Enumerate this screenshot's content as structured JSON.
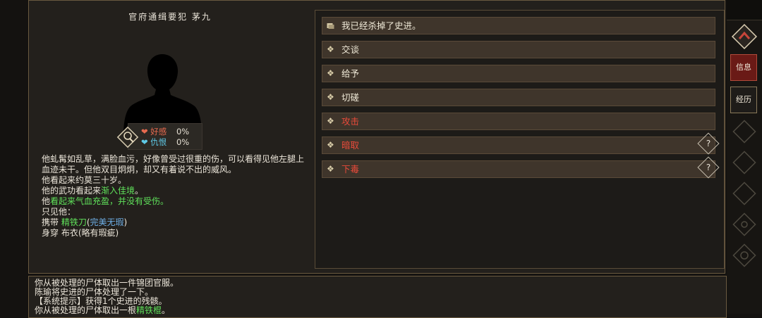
{
  "npc": {
    "title": "官府通缉要犯 茅九",
    "stats": [
      {
        "icon": "heart-icon",
        "label": "好感",
        "value": "0%",
        "color": "#e86a4f"
      },
      {
        "icon": "heart-icon",
        "label": "仇恨",
        "value": "0%",
        "color": "#5fc9e6"
      }
    ],
    "description": [
      {
        "segments": [
          {
            "text": "他虬髯如乱草，满脸血污，好像曾受过很重的伤，可以看得见他左腿上血迹未干。但他双目炯炯，却又有着说不出的威风。",
            "style": ""
          }
        ]
      },
      {
        "segments": [
          {
            "text": "他看起来约莫三十岁。",
            "style": ""
          }
        ]
      },
      {
        "segments": [
          {
            "text": "他的武功看起来",
            "style": ""
          },
          {
            "text": "渐入佳境",
            "style": "green"
          },
          {
            "text": "。",
            "style": ""
          }
        ]
      },
      {
        "segments": [
          {
            "text": "他",
            "style": ""
          },
          {
            "text": "看起来气血充盈，并没有受伤。",
            "style": "green"
          }
        ]
      },
      {
        "segments": [
          {
            "text": "只见他：",
            "style": ""
          }
        ]
      },
      {
        "segments": [
          {
            "text": "    携带 ",
            "style": ""
          },
          {
            "text": "精铁刀",
            "style": "green"
          },
          {
            "text": "(",
            "style": ""
          },
          {
            "text": "完美无瑕",
            "style": "blue"
          },
          {
            "text": ")",
            "style": ""
          }
        ]
      },
      {
        "segments": [
          {
            "text": "    身穿 布衣(略有瑕疵)",
            "style": ""
          }
        ]
      }
    ]
  },
  "actions": [
    {
      "label": "我已经杀掉了史进。",
      "icon": "quest-icon",
      "style": "normal",
      "help": false
    },
    {
      "label": "交谈",
      "icon": "diamond-icon",
      "style": "normal",
      "help": false
    },
    {
      "label": "给予",
      "icon": "diamond-icon",
      "style": "normal",
      "help": false
    },
    {
      "label": "切磋",
      "icon": "diamond-icon",
      "style": "normal",
      "help": false
    },
    {
      "label": "攻击",
      "icon": "diamond-icon",
      "style": "red",
      "help": false
    },
    {
      "label": "暗取",
      "icon": "diamond-icon",
      "style": "red",
      "help": true
    },
    {
      "label": "下毒",
      "icon": "diamond-icon",
      "style": "red",
      "help": true
    }
  ],
  "help_glyph": "?",
  "sidebar": {
    "tabs": [
      {
        "label": "信息",
        "active": true
      },
      {
        "label": "经历",
        "active": false
      }
    ]
  },
  "log": [
    {
      "segments": [
        {
          "text": "你从被处理的尸体取出一件锦团官服。",
          "style": ""
        }
      ]
    },
    {
      "segments": [
        {
          "text": "陈瑜将史进的尸体处理了一下。",
          "style": ""
        }
      ]
    },
    {
      "segments": [
        {
          "text": "【系统提示】获得1个史进的残骸。",
          "style": ""
        }
      ]
    },
    {
      "segments": [
        {
          "text": "你从被处理的尸体取出一根",
          "style": ""
        },
        {
          "text": "精铁棍",
          "style": "green"
        },
        {
          "text": "。",
          "style": ""
        }
      ]
    }
  ]
}
